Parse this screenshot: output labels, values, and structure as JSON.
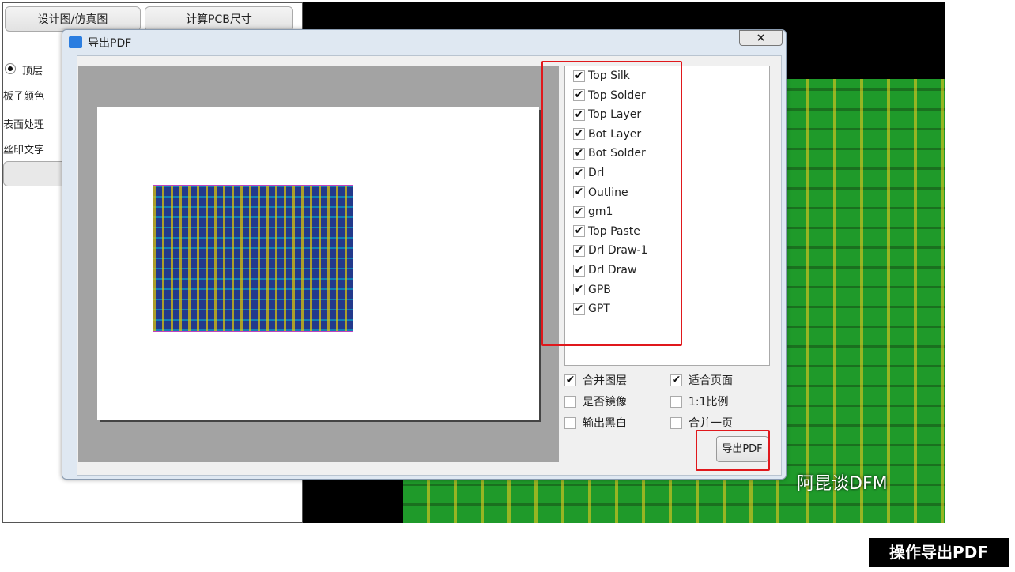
{
  "app": {
    "tabs": [
      "设计图/仿真图",
      "计算PCB尺寸"
    ],
    "radio_label": "顶层",
    "labels": [
      "板子颜色",
      "表面处理",
      "丝印文字"
    ]
  },
  "dialog": {
    "title": "导出PDF",
    "close": "×",
    "layers": [
      "Top Silk",
      "Top Solder",
      "Top Layer",
      "Bot Layer",
      "Bot Solder",
      "Drl",
      "Outline",
      "gm1",
      "Top Paste",
      "Drl Draw-1",
      "Drl Draw",
      "GPB",
      "GPT"
    ],
    "options": [
      {
        "label": "合并图层",
        "checked": true
      },
      {
        "label": "适合页面",
        "checked": true
      },
      {
        "label": "是否镜像",
        "checked": false
      },
      {
        "label": "1:1比例",
        "checked": false
      },
      {
        "label": "输出黑白",
        "checked": false
      },
      {
        "label": "合并一页",
        "checked": false
      }
    ],
    "export_button": "导出PDF"
  },
  "watermark": "阿昆谈DFM",
  "caption": "操作导出PDF",
  "colors": {
    "highlight": "#e0181c",
    "pcb_green": "#1f9a2a"
  }
}
